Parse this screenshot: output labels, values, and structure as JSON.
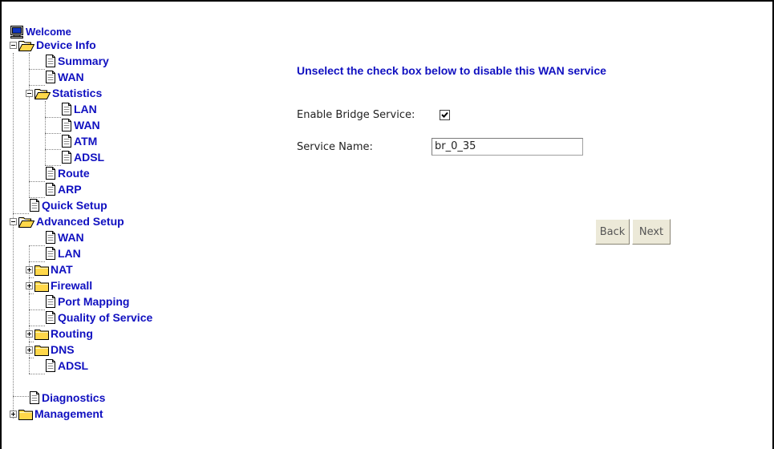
{
  "nav": {
    "root": "Welcome",
    "items": [
      {
        "label": "Device Info",
        "type": "folder-open"
      },
      {
        "label": "Summary",
        "type": "page"
      },
      {
        "label": "WAN",
        "type": "page"
      },
      {
        "label": "Statistics",
        "type": "folder-open"
      },
      {
        "label": "LAN",
        "type": "page"
      },
      {
        "label": "WAN",
        "type": "page"
      },
      {
        "label": "ATM",
        "type": "page"
      },
      {
        "label": "ADSL",
        "type": "page"
      },
      {
        "label": "Route",
        "type": "page"
      },
      {
        "label": "ARP",
        "type": "page"
      },
      {
        "label": "Quick Setup",
        "type": "page"
      },
      {
        "label": "Advanced Setup",
        "type": "folder-open"
      },
      {
        "label": "WAN",
        "type": "page"
      },
      {
        "label": "LAN",
        "type": "page"
      },
      {
        "label": "NAT",
        "type": "folder-closed"
      },
      {
        "label": "Firewall",
        "type": "folder-closed"
      },
      {
        "label": "Port Mapping",
        "type": "page"
      },
      {
        "label": "Quality of Service",
        "type": "page"
      },
      {
        "label": "Routing",
        "type": "folder-closed"
      },
      {
        "label": "DNS",
        "type": "folder-closed"
      },
      {
        "label": "ADSL",
        "type": "page"
      },
      {
        "label": "Diagnostics",
        "type": "page"
      },
      {
        "label": "Management",
        "type": "folder-closed"
      }
    ]
  },
  "main": {
    "heading": "Unselect the check box below to disable this WAN service",
    "enable_label": "Enable Bridge Service:",
    "enable_checked": true,
    "service_label": "Service Name:",
    "service_value": "br_0_35",
    "back_label": "Back",
    "next_label": "Next"
  },
  "colors": {
    "link": "#1010c0",
    "folder": "#ffd84a",
    "button_face": "#ece9d8"
  }
}
